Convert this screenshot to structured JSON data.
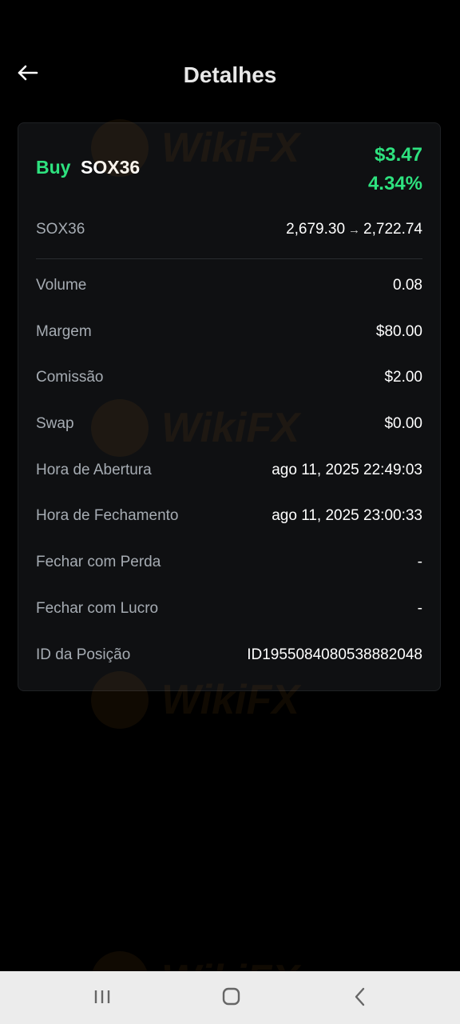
{
  "header": {
    "title": "Detalhes",
    "back_icon": "arrow-left-icon"
  },
  "trade": {
    "side": "Buy",
    "symbol": "SOX36",
    "pnl_amount": "$3.47",
    "pnl_percent": "4.34%",
    "price_label": "SOX36",
    "open_price": "2,679.30",
    "arrow": "→",
    "close_price": "2,722.74"
  },
  "details": [
    {
      "label": "Volume",
      "value": "0.08"
    },
    {
      "label": "Margem",
      "value": "$80.00"
    },
    {
      "label": "Comissão",
      "value": "$2.00"
    },
    {
      "label": "Swap",
      "value": "$0.00"
    },
    {
      "label": "Hora de Abertura",
      "value": "ago 11, 2025 22:49:03"
    },
    {
      "label": "Hora de Fechamento",
      "value": "ago 11, 2025 23:00:33"
    },
    {
      "label": "Fechar com Perda",
      "value": "-"
    },
    {
      "label": "Fechar com Lucro",
      "value": "-"
    },
    {
      "label": "ID da Posição",
      "value": "ID1955084080538882048"
    }
  ],
  "colors": {
    "background": "#000000",
    "card": "#0f1012",
    "accent_green": "#2ee27f",
    "label_gray": "#a6acb3",
    "nav_bar": "#ececec"
  },
  "watermark": {
    "text": "WikiFX"
  },
  "system_nav": {
    "recent_apps_icon": "recent-apps-icon",
    "home_icon": "home-icon",
    "back_icon": "chevron-left-icon"
  }
}
